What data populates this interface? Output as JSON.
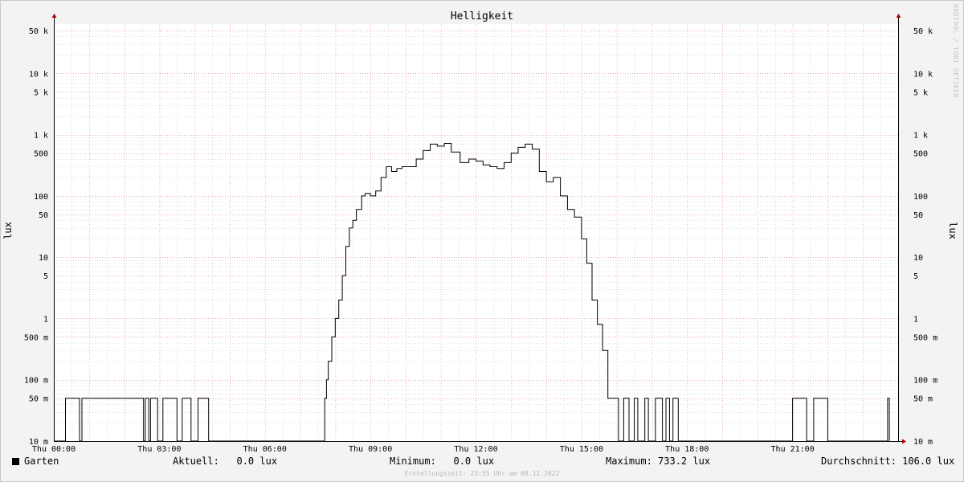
{
  "chart_data": {
    "type": "line",
    "title": "Helligkeit",
    "ylabel": "lux",
    "xlabel": "",
    "yscale": "log",
    "ylim": [
      0.01,
      50000
    ],
    "xlim": [
      0,
      24
    ],
    "x_unit": "hours (Thu)",
    "x_ticks": [
      {
        "x": 0,
        "label": "Thu 00:00"
      },
      {
        "x": 3,
        "label": "Thu 03:00"
      },
      {
        "x": 6,
        "label": "Thu 06:00"
      },
      {
        "x": 9,
        "label": "Thu 09:00"
      },
      {
        "x": 12,
        "label": "Thu 12:00"
      },
      {
        "x": 15,
        "label": "Thu 15:00"
      },
      {
        "x": 18,
        "label": "Thu 18:00"
      },
      {
        "x": 21,
        "label": "Thu 21:00"
      }
    ],
    "y_ticks": [
      {
        "v": 50000,
        "label": "50 k"
      },
      {
        "v": 10000,
        "label": "10 k"
      },
      {
        "v": 5000,
        "label": "5 k"
      },
      {
        "v": 1000,
        "label": "1 k"
      },
      {
        "v": 500,
        "label": "500"
      },
      {
        "v": 100,
        "label": "100"
      },
      {
        "v": 50,
        "label": "50"
      },
      {
        "v": 10,
        "label": "10"
      },
      {
        "v": 5,
        "label": "5"
      },
      {
        "v": 1,
        "label": "1"
      },
      {
        "v": 0.5,
        "label": "500 m"
      },
      {
        "v": 0.1,
        "label": "100 m"
      },
      {
        "v": 0.05,
        "label": "50 m"
      },
      {
        "v": 0.01,
        "label": "10 m"
      }
    ],
    "grid": true,
    "series": [
      {
        "name": "Garten",
        "color": "#000000",
        "x": [
          0.0,
          0.33,
          0.73,
          0.8,
          2.2,
          2.55,
          2.6,
          2.7,
          2.75,
          2.95,
          3.1,
          3.5,
          3.65,
          3.9,
          4.1,
          4.4,
          7.7,
          7.75,
          7.8,
          7.9,
          8.0,
          8.1,
          8.2,
          8.3,
          8.4,
          8.5,
          8.6,
          8.75,
          8.85,
          9.0,
          9.15,
          9.3,
          9.45,
          9.6,
          9.75,
          9.9,
          10.1,
          10.3,
          10.5,
          10.7,
          10.9,
          11.1,
          11.3,
          11.55,
          11.8,
          12.0,
          12.2,
          12.4,
          12.6,
          12.8,
          13.0,
          13.2,
          13.4,
          13.6,
          13.8,
          14.0,
          14.2,
          14.4,
          14.6,
          14.8,
          15.0,
          15.15,
          15.3,
          15.45,
          15.6,
          15.75,
          15.9,
          16.05,
          16.2,
          16.35,
          16.5,
          16.6,
          16.7,
          16.8,
          16.9,
          17.0,
          17.1,
          17.2,
          17.3,
          17.4,
          17.5,
          17.6,
          17.75,
          21.0,
          21.4,
          21.6,
          22.0,
          23.7,
          23.75
        ],
        "y": [
          0.01,
          0.05,
          0.01,
          0.05,
          0.05,
          0.01,
          0.05,
          0.01,
          0.05,
          0.01,
          0.05,
          0.01,
          0.05,
          0.01,
          0.05,
          0.01,
          0.05,
          0.1,
          0.2,
          0.5,
          1,
          2,
          5,
          15,
          30,
          40,
          60,
          100,
          110,
          100,
          120,
          200,
          300,
          250,
          280,
          300,
          300,
          400,
          550,
          700,
          650,
          720,
          520,
          350,
          400,
          370,
          320,
          300,
          280,
          350,
          500,
          620,
          700,
          580,
          250,
          170,
          200,
          100,
          60,
          45,
          20,
          8,
          2,
          0.8,
          0.3,
          0.05,
          0.05,
          0.01,
          0.05,
          0.01,
          0.05,
          0.01,
          0.01,
          0.05,
          0.01,
          0.01,
          0.05,
          0.05,
          0.01,
          0.05,
          0.01,
          0.05,
          0.01,
          0.05,
          0.01,
          0.05,
          0.01,
          0.05,
          0.01
        ]
      }
    ]
  },
  "legend": {
    "series_name": "Garten",
    "current_label": "Aktuell:",
    "current_value": "0.0 lux",
    "min_label": "Minimum:",
    "min_value": "0.0 lux",
    "max_label": "Maximum:",
    "max_value": "733.2 lux",
    "avg_label": "Durchschnitt:",
    "avg_value": "106.0 lux"
  },
  "footer": "Erstellungszeit: 23:55 Uhr am 08.12.2022",
  "watermark": "RRDTOOL / TOBI OETIKER",
  "colors": {
    "background": "#f3f3f3",
    "canvas": "#ffffff",
    "major_grid": "#e8a0a0",
    "minor_grid": "#c8c8c8",
    "axis": "#000000",
    "arrow": "#aa0000"
  }
}
